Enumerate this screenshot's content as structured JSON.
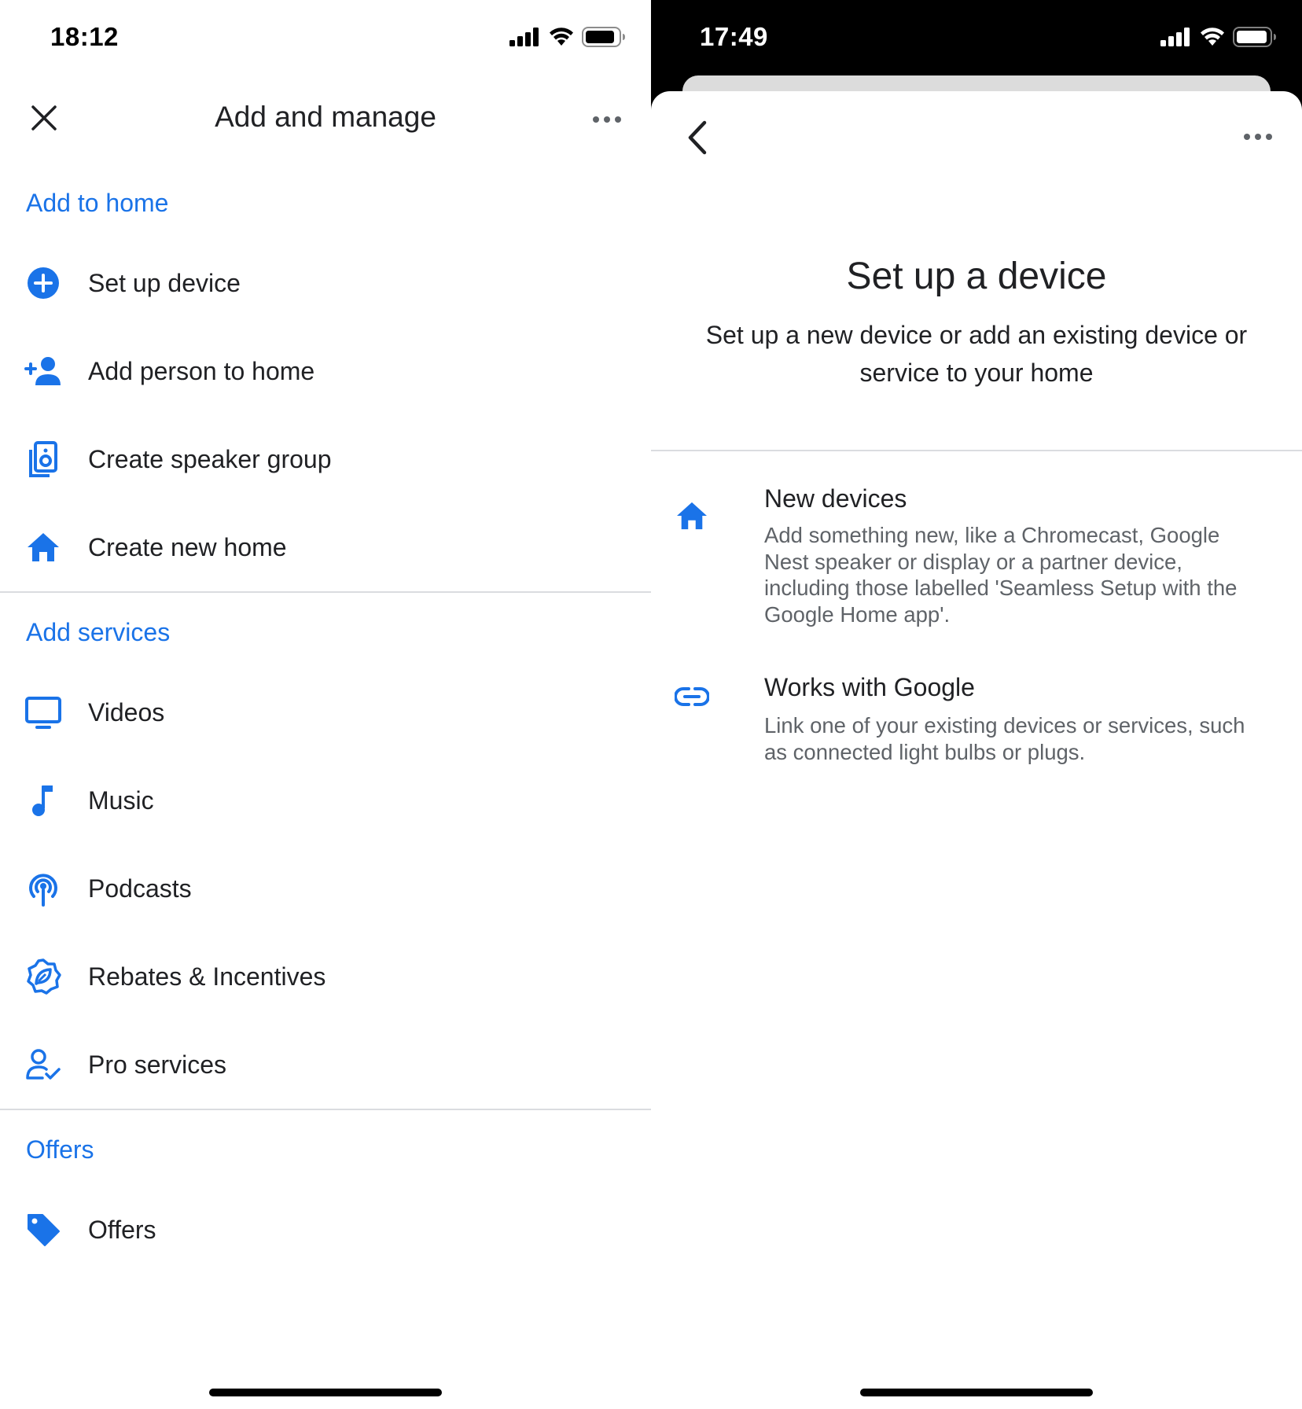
{
  "left": {
    "status_time": "18:12",
    "title": "Add and manage",
    "sections": [
      {
        "header": "Add to home",
        "items": [
          {
            "label": "Set up device",
            "icon": "add-circle-icon"
          },
          {
            "label": "Add person to home",
            "icon": "person-add-icon"
          },
          {
            "label": "Create speaker group",
            "icon": "speaker-group-icon"
          },
          {
            "label": "Create new home",
            "icon": "home-icon"
          }
        ]
      },
      {
        "header": "Add services",
        "items": [
          {
            "label": "Videos",
            "icon": "tv-icon"
          },
          {
            "label": "Music",
            "icon": "music-note-icon"
          },
          {
            "label": "Podcasts",
            "icon": "podcast-icon"
          },
          {
            "label": "Rebates & Incentives",
            "icon": "eco-badge-icon"
          },
          {
            "label": "Pro services",
            "icon": "person-check-icon"
          }
        ]
      },
      {
        "header": "Offers",
        "items": [
          {
            "label": "Offers",
            "icon": "tag-icon"
          }
        ]
      }
    ]
  },
  "right": {
    "status_time": "17:49",
    "title": "Set up a device",
    "subtitle": "Set up a new device or add an existing device or service to your home",
    "options": [
      {
        "title": "New devices",
        "description_lines": [
          "Add something new, like a Chromecast, Google",
          "Nest speaker or display or a partner device,",
          "including those labelled 'Seamless Setup with the",
          "Google Home app'."
        ],
        "icon": "home-icon"
      },
      {
        "title": "Works with Google",
        "description_lines": [
          "Link one of your existing devices or services, such",
          "as connected light bulbs or plugs."
        ],
        "icon": "link-icon"
      }
    ]
  },
  "colors": {
    "accent": "#1a73e8",
    "text_primary": "#202124",
    "text_secondary": "#5f6368",
    "divider": "#dadce0"
  }
}
